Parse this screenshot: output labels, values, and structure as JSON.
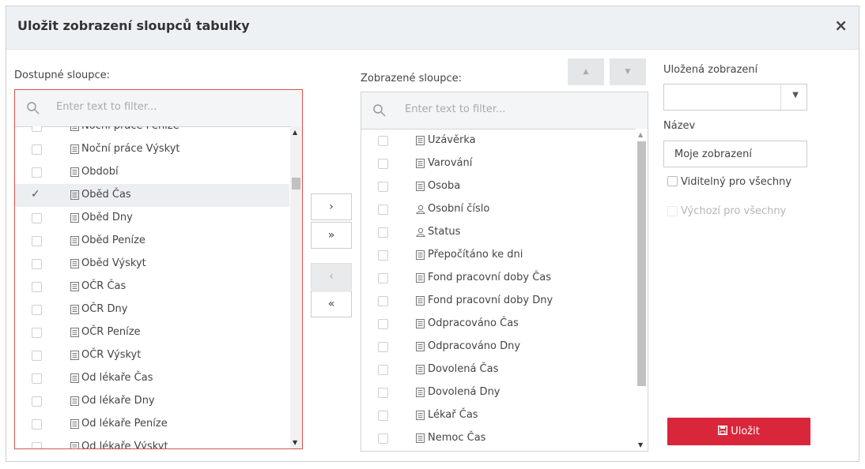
{
  "dialog": {
    "title": "Uložit zobrazení sloupců tabulky",
    "close_glyph": "×"
  },
  "available": {
    "label": "Dostupné sloupce:",
    "filter_placeholder": "Enter text to filter...",
    "items": [
      {
        "label": "Noční práce Peníze",
        "checked": false,
        "icon": "list-icon"
      },
      {
        "label": "Noční práce Výskyt",
        "checked": false,
        "icon": "list-icon"
      },
      {
        "label": "Období",
        "checked": false,
        "icon": "list-icon"
      },
      {
        "label": "Oběd Čas",
        "checked": true,
        "icon": "list-icon"
      },
      {
        "label": "Oběd Dny",
        "checked": false,
        "icon": "list-icon"
      },
      {
        "label": "Oběd Peníze",
        "checked": false,
        "icon": "list-icon"
      },
      {
        "label": "Oběd Výskyt",
        "checked": false,
        "icon": "list-icon"
      },
      {
        "label": "OČR Čas",
        "checked": false,
        "icon": "list-icon"
      },
      {
        "label": "OČR Dny",
        "checked": false,
        "icon": "list-icon"
      },
      {
        "label": "OČR Peníze",
        "checked": false,
        "icon": "list-icon"
      },
      {
        "label": "OČR Výskyt",
        "checked": false,
        "icon": "list-icon"
      },
      {
        "label": "Od lékaře Čas",
        "checked": false,
        "icon": "list-icon"
      },
      {
        "label": "Od lékaře Dny",
        "checked": false,
        "icon": "list-icon"
      },
      {
        "label": "Od lékaře Peníze",
        "checked": false,
        "icon": "list-icon"
      },
      {
        "label": "Od lékaře Výskyt",
        "checked": false,
        "icon": "list-icon"
      }
    ]
  },
  "transfer": {
    "add": "›",
    "add_all": "»",
    "remove": "‹",
    "remove_all": "«"
  },
  "displayed": {
    "label": "Zobrazené sloupce:",
    "filter_placeholder": "Enter text to filter...",
    "items": [
      {
        "label": "Uzávěrka",
        "icon": "list-icon"
      },
      {
        "label": "Varování",
        "icon": "list-icon"
      },
      {
        "label": "Osoba",
        "icon": "list-icon"
      },
      {
        "label": "Osobní číslo",
        "icon": "person-icon"
      },
      {
        "label": "Status",
        "icon": "person-icon"
      },
      {
        "label": "Přepočítáno ke dni",
        "icon": "list-icon"
      },
      {
        "label": "Fond pracovní doby Čas",
        "icon": "list-icon"
      },
      {
        "label": "Fond pracovní doby Dny",
        "icon": "list-icon"
      },
      {
        "label": "Odpracováno Čas",
        "icon": "list-icon"
      },
      {
        "label": "Odpracováno Dny",
        "icon": "list-icon"
      },
      {
        "label": "Dovolená Čas",
        "icon": "list-icon"
      },
      {
        "label": "Dovolená Dny",
        "icon": "list-icon"
      },
      {
        "label": "Lékař Čas",
        "icon": "list-icon"
      },
      {
        "label": "Nemoc Čas",
        "icon": "list-icon"
      }
    ]
  },
  "order": {
    "up": "▲",
    "down": "▼"
  },
  "saved_views": {
    "label": "Uložená zobrazení",
    "selected": "",
    "name_label": "Název",
    "name_value": "Moje zobrazení",
    "visible_label": "Viditelný pro všechny",
    "default_label": "Výchozí pro všechny",
    "save_label": "Uložit"
  },
  "colors": {
    "accent_red": "#d9263b",
    "header_bg": "#eef1f4",
    "selected_row": "#eceff1"
  }
}
